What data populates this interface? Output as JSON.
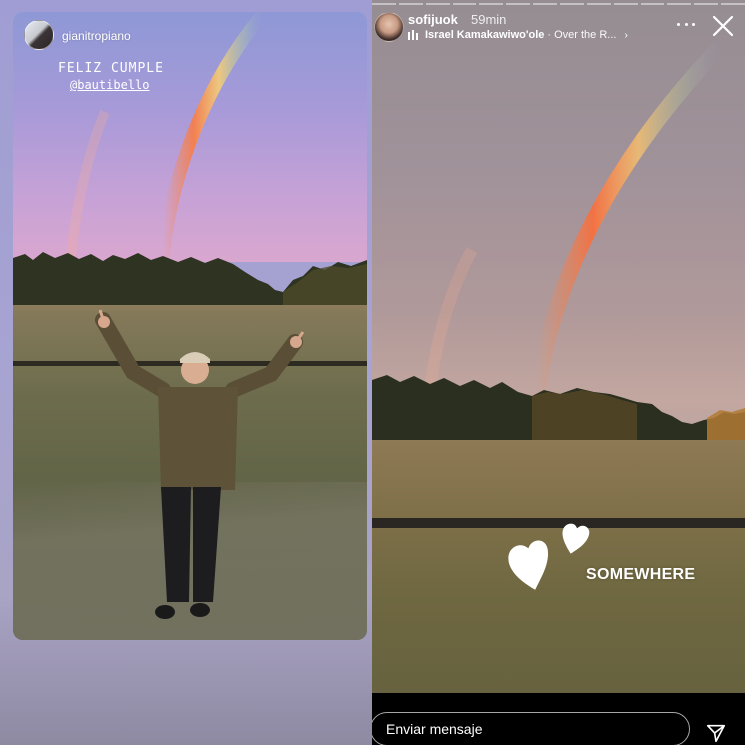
{
  "left_story": {
    "username": "gianitropiano",
    "caption_line1": "FELIZ CUMPLE",
    "caption_line2": "@bautibello"
  },
  "right_story": {
    "username": "sofijuok",
    "time": "59min",
    "music": {
      "artist": "Israel Kamakawiwo'ole",
      "separator": "·",
      "song": "Over the R...",
      "chevron": "›"
    },
    "sticker_text": "SOMEWHERE",
    "progress_segments": 14
  },
  "reply": {
    "placeholder": "Enviar mensaje"
  },
  "icons": {
    "more": "more-horizontal-icon",
    "close": "close-icon",
    "send": "send-icon",
    "music": "music-bars-icon",
    "sticker": "hearts-sticker-icon"
  }
}
